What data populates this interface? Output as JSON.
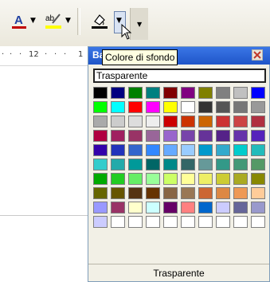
{
  "toolbar": {
    "font_color_glyph": "A",
    "font_color_accent": "#c00000",
    "highlight_glyph": "ab",
    "highlight_accent": "#ffff00",
    "bg_color_accent": "#000000"
  },
  "ruler": {
    "ticks": [
      "12",
      "1"
    ]
  },
  "panel": {
    "title": "Backg",
    "none_label": "Trasparente",
    "footer_label": "Trasparente",
    "colors": [
      [
        "#000000",
        "#000080",
        "#008000",
        "#008080",
        "#800000",
        "#800080",
        "#808000",
        "#808080",
        "#c0c0c0",
        "#0000ff"
      ],
      [
        "#00ff00",
        "#00ffff",
        "#ff0000",
        "#ff00ff",
        "#ffff00",
        "#ffffff",
        "#333333",
        "#555555",
        "#777777",
        "#999999"
      ],
      [
        "#aaaaaa",
        "#cccccc",
        "#dddddd",
        "#eeeeee",
        "#cc0000",
        "#cc3300",
        "#cc6600",
        "#cc3333",
        "#cc4444",
        "#b03040"
      ],
      [
        "#b00040",
        "#a02060",
        "#993366",
        "#996699",
        "#9966cc",
        "#7744aa",
        "#663399",
        "#552288",
        "#6633aa",
        "#5522bb"
      ],
      [
        "#3300aa",
        "#2233bb",
        "#3366cc",
        "#3388ff",
        "#66aaff",
        "#99ccff",
        "#0099cc",
        "#33aacc",
        "#00cccc",
        "#22bbbb"
      ],
      [
        "#33cccc",
        "#22aaaa",
        "#009999",
        "#006666",
        "#008888",
        "#336666",
        "#669999",
        "#339988",
        "#449977",
        "#559966"
      ],
      [
        "#00aa00",
        "#22cc22",
        "#66ee66",
        "#99ff99",
        "#ccff66",
        "#ffff99",
        "#eeee66",
        "#cccc33",
        "#aaaa22",
        "#888800"
      ],
      [
        "#666600",
        "#665500",
        "#553311",
        "#663300",
        "#886644",
        "#997755",
        "#cc6633",
        "#dd8844",
        "#ee9955",
        "#ffcc99"
      ],
      [
        "#9999ff",
        "#993366",
        "#ffffcc",
        "#ccffff",
        "#660066",
        "#ff8080",
        "#0066cc",
        "#ccccff",
        "#666699",
        "#9999cc"
      ],
      [
        "#ccccff",
        "#ffffff",
        "#ffffff",
        "#ffffff",
        "#ffffff",
        "#ffffff",
        "#ffffff",
        "#ffffff",
        "#ffffff",
        "#ffffff"
      ]
    ]
  },
  "tooltip": {
    "text": "Colore di sfondo"
  }
}
